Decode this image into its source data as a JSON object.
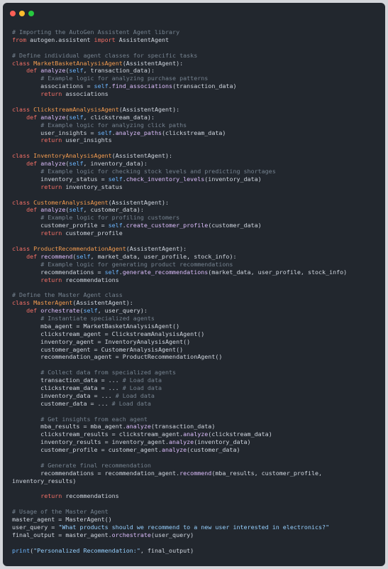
{
  "window": {
    "controls": [
      "close",
      "minimize",
      "maximize"
    ]
  },
  "colors": {
    "background": "#22272e",
    "comment": "#768390",
    "keyword": "#f47067",
    "class": "#f69d50",
    "function": "#dcbdfb",
    "self": "#6cb6ff",
    "string": "#96d0ff",
    "text": "#d1d7e0"
  },
  "code_lines": [
    [
      [
        "comment",
        "# Importing the AutoGen Assistent Agent library"
      ]
    ],
    [
      [
        "keyword",
        "from"
      ],
      [
        "plain",
        " autogen.assistent "
      ],
      [
        "keyword",
        "import"
      ],
      [
        "plain",
        " AssistentAgent"
      ]
    ],
    [],
    [
      [
        "comment",
        "# Define individual agent classes for specific tasks"
      ]
    ],
    [
      [
        "keyword",
        "class"
      ],
      [
        "plain",
        " "
      ],
      [
        "class",
        "MarketBasketAnalysisAgent"
      ],
      [
        "plain",
        "(AssistentAgent):"
      ]
    ],
    [
      [
        "plain",
        "    "
      ],
      [
        "keyword",
        "def"
      ],
      [
        "plain",
        " "
      ],
      [
        "func",
        "analyze"
      ],
      [
        "plain",
        "("
      ],
      [
        "self",
        "self"
      ],
      [
        "plain",
        ", transaction_data):"
      ]
    ],
    [
      [
        "plain",
        "        "
      ],
      [
        "comment",
        "# Example logic for analyzing purchase patterns"
      ]
    ],
    [
      [
        "plain",
        "        associations = "
      ],
      [
        "self",
        "self"
      ],
      [
        "plain",
        "."
      ],
      [
        "func",
        "find_associations"
      ],
      [
        "plain",
        "(transaction_data)"
      ]
    ],
    [
      [
        "plain",
        "        "
      ],
      [
        "keyword",
        "return"
      ],
      [
        "plain",
        " associations"
      ]
    ],
    [],
    [
      [
        "keyword",
        "class"
      ],
      [
        "plain",
        " "
      ],
      [
        "class",
        "ClickstreamAnalysisAgent"
      ],
      [
        "plain",
        "(AssistentAgent):"
      ]
    ],
    [
      [
        "plain",
        "    "
      ],
      [
        "keyword",
        "def"
      ],
      [
        "plain",
        " "
      ],
      [
        "func",
        "analyze"
      ],
      [
        "plain",
        "("
      ],
      [
        "self",
        "self"
      ],
      [
        "plain",
        ", clickstream_data):"
      ]
    ],
    [
      [
        "plain",
        "        "
      ],
      [
        "comment",
        "# Example logic for analyzing click paths"
      ]
    ],
    [
      [
        "plain",
        "        user_insights = "
      ],
      [
        "self",
        "self"
      ],
      [
        "plain",
        "."
      ],
      [
        "func",
        "analyze_paths"
      ],
      [
        "plain",
        "(clickstream_data)"
      ]
    ],
    [
      [
        "plain",
        "        "
      ],
      [
        "keyword",
        "return"
      ],
      [
        "plain",
        " user_insights"
      ]
    ],
    [],
    [
      [
        "keyword",
        "class"
      ],
      [
        "plain",
        " "
      ],
      [
        "class",
        "InventoryAnalysisAgent"
      ],
      [
        "plain",
        "(AssistentAgent):"
      ]
    ],
    [
      [
        "plain",
        "    "
      ],
      [
        "keyword",
        "def"
      ],
      [
        "plain",
        " "
      ],
      [
        "func",
        "analyze"
      ],
      [
        "plain",
        "("
      ],
      [
        "self",
        "self"
      ],
      [
        "plain",
        ", inventory_data):"
      ]
    ],
    [
      [
        "plain",
        "        "
      ],
      [
        "comment",
        "# Example logic for checking stock levels and predicting shortages"
      ]
    ],
    [
      [
        "plain",
        "        inventory_status = "
      ],
      [
        "self",
        "self"
      ],
      [
        "plain",
        "."
      ],
      [
        "func",
        "check_inventory_levels"
      ],
      [
        "plain",
        "(inventory_data)"
      ]
    ],
    [
      [
        "plain",
        "        "
      ],
      [
        "keyword",
        "return"
      ],
      [
        "plain",
        " inventory_status"
      ]
    ],
    [],
    [
      [
        "keyword",
        "class"
      ],
      [
        "plain",
        " "
      ],
      [
        "class",
        "CustomerAnalysisAgent"
      ],
      [
        "plain",
        "(AssistentAgent):"
      ]
    ],
    [
      [
        "plain",
        "    "
      ],
      [
        "keyword",
        "def"
      ],
      [
        "plain",
        " "
      ],
      [
        "func",
        "analyze"
      ],
      [
        "plain",
        "("
      ],
      [
        "self",
        "self"
      ],
      [
        "plain",
        ", customer_data):"
      ]
    ],
    [
      [
        "plain",
        "        "
      ],
      [
        "comment",
        "# Example logic for profiling customers"
      ]
    ],
    [
      [
        "plain",
        "        customer_profile = "
      ],
      [
        "self",
        "self"
      ],
      [
        "plain",
        "."
      ],
      [
        "func",
        "create_customer_profile"
      ],
      [
        "plain",
        "(customer_data)"
      ]
    ],
    [
      [
        "plain",
        "        "
      ],
      [
        "keyword",
        "return"
      ],
      [
        "plain",
        " customer_profile"
      ]
    ],
    [],
    [
      [
        "keyword",
        "class"
      ],
      [
        "plain",
        " "
      ],
      [
        "class",
        "ProductRecommendationAgent"
      ],
      [
        "plain",
        "(AssistentAgent):"
      ]
    ],
    [
      [
        "plain",
        "    "
      ],
      [
        "keyword",
        "def"
      ],
      [
        "plain",
        " "
      ],
      [
        "func",
        "recommend"
      ],
      [
        "plain",
        "("
      ],
      [
        "self",
        "self"
      ],
      [
        "plain",
        ", market_data, user_profile, stock_info):"
      ]
    ],
    [
      [
        "plain",
        "        "
      ],
      [
        "comment",
        "# Example logic for generating product recommendations"
      ]
    ],
    [
      [
        "plain",
        "        recommendations = "
      ],
      [
        "self",
        "self"
      ],
      [
        "plain",
        "."
      ],
      [
        "func",
        "generate_recommendations"
      ],
      [
        "plain",
        "(market_data, user_profile, stock_info)"
      ]
    ],
    [
      [
        "plain",
        "        "
      ],
      [
        "keyword",
        "return"
      ],
      [
        "plain",
        " recommendations"
      ]
    ],
    [],
    [
      [
        "comment",
        "# Define the Master Agent class"
      ]
    ],
    [
      [
        "keyword",
        "class"
      ],
      [
        "plain",
        " "
      ],
      [
        "class",
        "MasterAgent"
      ],
      [
        "plain",
        "(AssistentAgent):"
      ]
    ],
    [
      [
        "plain",
        "    "
      ],
      [
        "keyword",
        "def"
      ],
      [
        "plain",
        " "
      ],
      [
        "func",
        "orchestrate"
      ],
      [
        "plain",
        "("
      ],
      [
        "self",
        "self"
      ],
      [
        "plain",
        ", user_query):"
      ]
    ],
    [
      [
        "plain",
        "        "
      ],
      [
        "comment",
        "# Instantiate specialized agents"
      ]
    ],
    [
      [
        "plain",
        "        mba_agent = MarketBasketAnalysisAgent()"
      ]
    ],
    [
      [
        "plain",
        "        clickstream_agent = ClickstreamAnalysisAgent()"
      ]
    ],
    [
      [
        "plain",
        "        inventory_agent = InventoryAnalysisAgent()"
      ]
    ],
    [
      [
        "plain",
        "        customer_agent = CustomerAnalysisAgent()"
      ]
    ],
    [
      [
        "plain",
        "        recommendation_agent = ProductRecommendationAgent()"
      ]
    ],
    [],
    [
      [
        "plain",
        "        "
      ],
      [
        "comment",
        "# Collect data from specialized agents"
      ]
    ],
    [
      [
        "plain",
        "        transaction_data = ... "
      ],
      [
        "comment",
        "# Load data"
      ]
    ],
    [
      [
        "plain",
        "        clickstream_data = ... "
      ],
      [
        "comment",
        "# Load data"
      ]
    ],
    [
      [
        "plain",
        "        inventory_data = ... "
      ],
      [
        "comment",
        "# Load data"
      ]
    ],
    [
      [
        "plain",
        "        customer_data = ... "
      ],
      [
        "comment",
        "# Load data"
      ]
    ],
    [],
    [
      [
        "plain",
        "        "
      ],
      [
        "comment",
        "# Get insights from each agent"
      ]
    ],
    [
      [
        "plain",
        "        mba_results = mba_agent."
      ],
      [
        "func",
        "analyze"
      ],
      [
        "plain",
        "(transaction_data)"
      ]
    ],
    [
      [
        "plain",
        "        clickstream_results = clickstream_agent."
      ],
      [
        "func",
        "analyze"
      ],
      [
        "plain",
        "(clickstream_data)"
      ]
    ],
    [
      [
        "plain",
        "        inventory_results = inventory_agent."
      ],
      [
        "func",
        "analyze"
      ],
      [
        "plain",
        "(inventory_data)"
      ]
    ],
    [
      [
        "plain",
        "        customer_profile = customer_agent."
      ],
      [
        "func",
        "analyze"
      ],
      [
        "plain",
        "(customer_data)"
      ]
    ],
    [],
    [
      [
        "plain",
        "        "
      ],
      [
        "comment",
        "# Generate final recommendation"
      ]
    ],
    [
      [
        "plain",
        "        recommendations = recommendation_agent."
      ],
      [
        "func",
        "recommend"
      ],
      [
        "plain",
        "(mba_results, customer_profile,"
      ]
    ],
    [
      [
        "plain",
        "inventory_results)"
      ]
    ],
    [],
    [
      [
        "plain",
        "        "
      ],
      [
        "keyword",
        "return"
      ],
      [
        "plain",
        " recommendations"
      ]
    ],
    [],
    [
      [
        "comment",
        "# Usage of the Master Agent"
      ]
    ],
    [
      [
        "plain",
        "master_agent = MasterAgent()"
      ]
    ],
    [
      [
        "plain",
        "user_query = "
      ],
      [
        "string",
        "\"What products should we recommend to a new user interested in electronics?\""
      ]
    ],
    [
      [
        "plain",
        "final_output = master_agent."
      ],
      [
        "func",
        "orchestrate"
      ],
      [
        "plain",
        "(user_query)"
      ]
    ],
    [],
    [
      [
        "builtin",
        "print"
      ],
      [
        "plain",
        "("
      ],
      [
        "string",
        "\"Personalized Recommendation:\""
      ],
      [
        "plain",
        ", final_output)"
      ]
    ]
  ]
}
